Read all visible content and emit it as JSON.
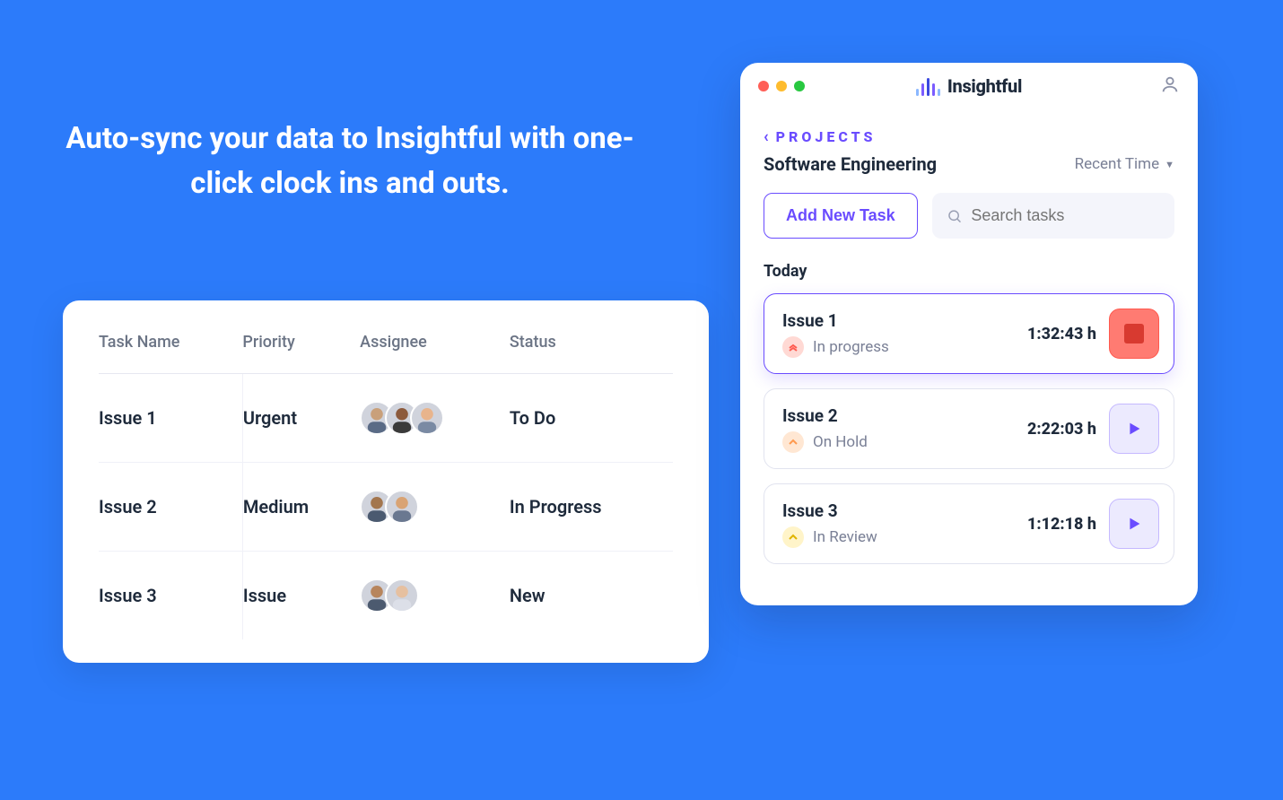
{
  "hero_text": "Auto-sync your data to Insightful with one-click clock ins and outs.",
  "table": {
    "headers": [
      "Task Name",
      "Priority",
      "Assignee",
      "Status"
    ],
    "rows": [
      {
        "task": "Issue 1",
        "priority": "Urgent",
        "assignees": 3,
        "status": "To Do"
      },
      {
        "task": "Issue 2",
        "priority": "Medium",
        "assignees": 2,
        "status": "In Progress"
      },
      {
        "task": "Issue 3",
        "priority": "Issue",
        "assignees": 2,
        "status": "New"
      }
    ]
  },
  "app": {
    "brand": "Insightful",
    "back_label": "PROJECTS",
    "project_title": "Software Engineering",
    "sort_label": "Recent Time",
    "add_task_label": "Add New Task",
    "search_placeholder": "Search tasks",
    "section_label": "Today",
    "tasks": [
      {
        "title": "Issue 1",
        "status": "In progress",
        "status_color": "red",
        "time": "1:32:43 h",
        "action": "stop",
        "active": true
      },
      {
        "title": "Issue 2",
        "status": "On Hold",
        "status_color": "orange",
        "time": "2:22:03 h",
        "action": "play",
        "active": false
      },
      {
        "title": "Issue 3",
        "status": "In Review",
        "status_color": "yellow",
        "time": "1:12:18 h",
        "action": "play",
        "active": false
      }
    ]
  },
  "colors": {
    "accent": "#6a4cff",
    "bg": "#2C7BFA"
  }
}
